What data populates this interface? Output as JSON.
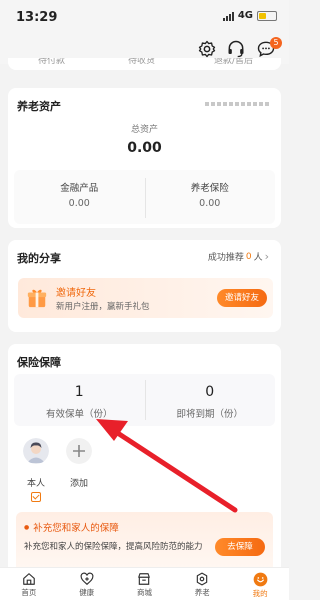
{
  "status_bar": {
    "time": "13:29",
    "network": "4G"
  },
  "header": {
    "message_badge": "5"
  },
  "cut_row": [
    "待付款",
    "待收货",
    "退款/售后"
  ],
  "assets": {
    "title": "养老资产",
    "total_label": "总资产",
    "total_value": "0.00",
    "metrics": [
      {
        "label": "金融产品",
        "value": "0.00"
      },
      {
        "label": "养老保险",
        "value": "0.00"
      }
    ]
  },
  "share": {
    "title": "我的分享",
    "referral_prefix": "成功推荐",
    "referral_count": "0",
    "referral_unit": "人",
    "invite_title": "邀请好友",
    "invite_subtitle": "新用户注册，赢新手礼包",
    "invite_button": "邀请好友"
  },
  "insurance": {
    "title": "保险保障",
    "stats": [
      {
        "value": "1",
        "label": "有效保单（份）"
      },
      {
        "value": "0",
        "label": "即将到期（份）"
      }
    ],
    "members": [
      {
        "label": "本人"
      },
      {
        "label": "添加"
      }
    ],
    "supplement_title": "补充您和家人的保障",
    "supplement_desc": "补充您和家人的保险保障，提高风险防范的能力",
    "supplement_button": "去保障"
  },
  "tabbar": [
    {
      "label": "首页",
      "icon": "home-icon"
    },
    {
      "label": "健康",
      "icon": "health-icon"
    },
    {
      "label": "商城",
      "icon": "store-icon"
    },
    {
      "label": "养老",
      "icon": "elderly-care-icon"
    },
    {
      "label": "我的",
      "icon": "profile-icon",
      "active": true
    }
  ],
  "colors": {
    "accent": "#f07a12",
    "arrow": "#e8202a"
  }
}
